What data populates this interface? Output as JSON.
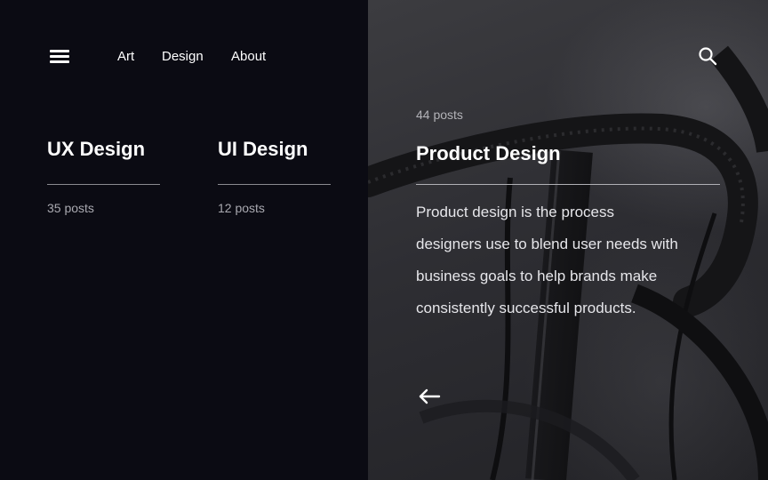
{
  "nav": {
    "links": [
      "Art",
      "Design",
      "About"
    ]
  },
  "icons": {
    "menu": "menu-icon",
    "search": "search-icon",
    "back": "arrow-left-icon"
  },
  "categories": [
    {
      "title": "UX Design",
      "count": "35 posts"
    },
    {
      "title": "UI Design",
      "count": "12 posts"
    }
  ],
  "featured": {
    "count": "44 posts",
    "title": "Product Design",
    "description": "Product design is the process designers use to blend user needs with business goals to help brands make consistently successful products."
  },
  "colors": {
    "background": "#0b0b13",
    "text": "#ffffff",
    "muted": "#a9a9b0"
  }
}
